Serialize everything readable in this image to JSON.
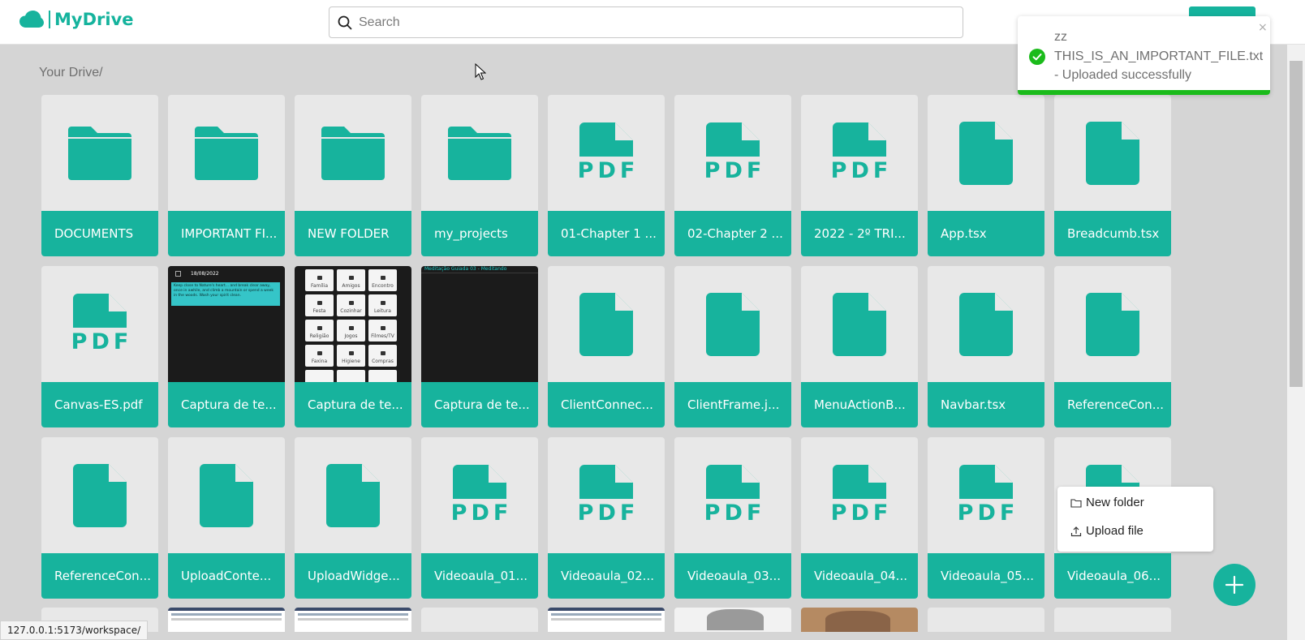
{
  "app": {
    "name": "MyDrive"
  },
  "search": {
    "placeholder": "Search"
  },
  "breadcrumb": "Your Drive/",
  "colors": {
    "accent": "#17b39d",
    "toast_progress": "#1bbb1b",
    "background": "#d5d5d5"
  },
  "files": [
    {
      "name": "DOCUMENTS",
      "type": "folder"
    },
    {
      "name": "IMPORTANT FI...",
      "type": "folder"
    },
    {
      "name": "NEW FOLDER",
      "type": "folder"
    },
    {
      "name": "my_projects",
      "type": "folder"
    },
    {
      "name": "01-Chapter 1 ...",
      "type": "pdf"
    },
    {
      "name": "02-Chapter 2 ...",
      "type": "pdf"
    },
    {
      "name": "2022 - 2º TRI...",
      "type": "pdf"
    },
    {
      "name": "App.tsx",
      "type": "file"
    },
    {
      "name": "Breadcumb.tsx",
      "type": "file"
    },
    {
      "name": "Canvas-ES.pdf",
      "type": "pdf"
    },
    {
      "name": "Captura de te...",
      "type": "image-note"
    },
    {
      "name": "Captura de te...",
      "type": "image-grid"
    },
    {
      "name": "Captura de te...",
      "type": "image-dark"
    },
    {
      "name": "ClientConnec...",
      "type": "file"
    },
    {
      "name": "ClientFrame.j...",
      "type": "file"
    },
    {
      "name": "MenuActionB...",
      "type": "file"
    },
    {
      "name": "Navbar.tsx",
      "type": "file"
    },
    {
      "name": "ReferenceCon...",
      "type": "file"
    },
    {
      "name": "ReferenceCon...",
      "type": "file"
    },
    {
      "name": "UploadConte...",
      "type": "file"
    },
    {
      "name": "UploadWidge...",
      "type": "file"
    },
    {
      "name": "Videoaula_01...",
      "type": "pdf"
    },
    {
      "name": "Videoaula_02...",
      "type": "pdf"
    },
    {
      "name": "Videoaula_03...",
      "type": "pdf"
    },
    {
      "name": "Videoaula_04...",
      "type": "pdf"
    },
    {
      "name": "Videoaula_05...",
      "type": "pdf"
    },
    {
      "name": "Videoaula_06...",
      "type": "pdf"
    }
  ],
  "thumbs": {
    "note": {
      "date": "18/08/2022",
      "text": "Keep close to Nature's heart... and break clear away, once in awhile, and climb a mountain or spend a week in the woods. Wash your spirit clean."
    },
    "grid": [
      "Família",
      "Amigos",
      "Encontro",
      "Festa",
      "Cozinhar",
      "Leitura",
      "Religião",
      "Jogos",
      "Filmes/TV",
      "Faxina",
      "Higiene",
      "Compras",
      "",
      "",
      ""
    ],
    "dark": {
      "title": "Meditação Guiada 03 - Meditando"
    }
  },
  "toast": {
    "line1": "zz",
    "line2": "THIS_IS_AN_IMPORTANT_FILE.txt",
    "line3": "- Uploaded successfully",
    "close": "×"
  },
  "menu": {
    "new_folder": "New folder",
    "upload_file": "Upload file"
  },
  "fab": {
    "icon": "plus-icon"
  },
  "statusbar": "127.0.0.1:5173/workspace/"
}
